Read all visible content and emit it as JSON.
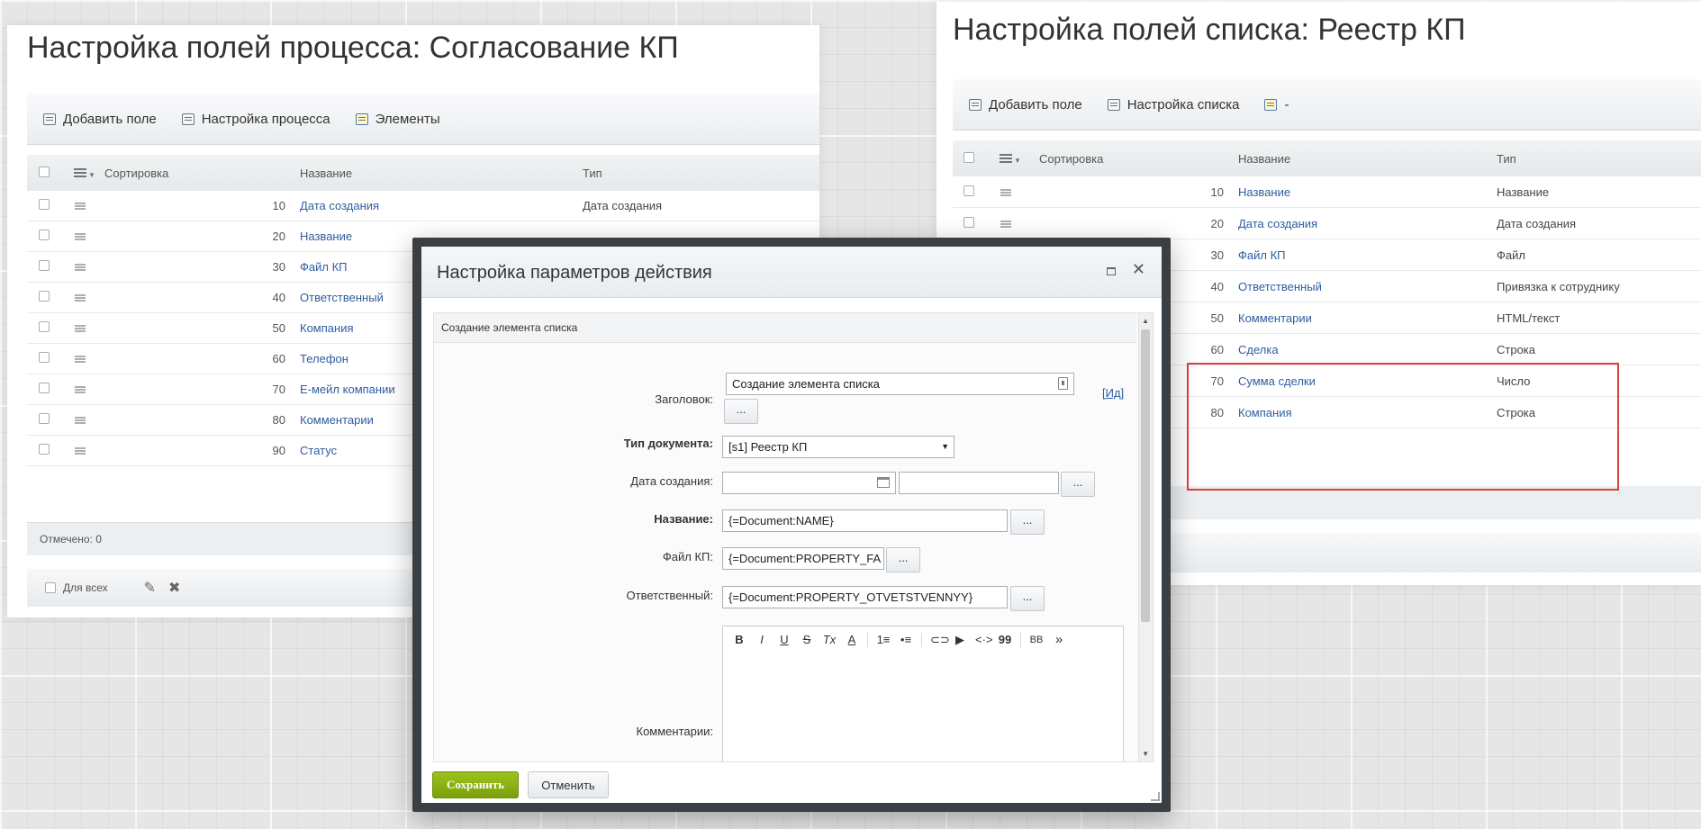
{
  "left_panel": {
    "title": "Настройка полей процесса: Согласование КП",
    "toolbar": [
      {
        "label": "Добавить поле",
        "icon": "add-field-icon"
      },
      {
        "label": "Настройка процесса",
        "icon": "settings-icon"
      },
      {
        "label": "Элементы",
        "icon": "elements-icon"
      }
    ],
    "columns": {
      "sort": "Сортировка",
      "name": "Название",
      "type": "Тип"
    },
    "rows": [
      {
        "sort": "10",
        "name": "Дата создания",
        "type": "Дата создания"
      },
      {
        "sort": "20",
        "name": "Название",
        "type": ""
      },
      {
        "sort": "30",
        "name": "Файл КП",
        "type": ""
      },
      {
        "sort": "40",
        "name": "Ответственный",
        "type": ""
      },
      {
        "sort": "50",
        "name": "Компания",
        "type": ""
      },
      {
        "sort": "60",
        "name": "Телефон",
        "type": ""
      },
      {
        "sort": "70",
        "name": "Е-мейл компании",
        "type": ""
      },
      {
        "sort": "80",
        "name": "Комментарии",
        "type": ""
      },
      {
        "sort": "90",
        "name": "Статус",
        "type": ""
      }
    ],
    "footer": "Отмечено: 0",
    "for_all": "Для всех"
  },
  "right_panel": {
    "title": "Настройка полей списка: Реестр КП",
    "toolbar": [
      {
        "label": "Добавить поле",
        "icon": "add-field-icon"
      },
      {
        "label": "Настройка списка",
        "icon": "settings-icon"
      },
      {
        "label": "-",
        "icon": "elements-icon"
      }
    ],
    "columns": {
      "sort": "Сортировка",
      "name": "Название",
      "type": "Тип"
    },
    "rows": [
      {
        "sort": "10",
        "name": "Название",
        "type": "Название"
      },
      {
        "sort": "20",
        "name": "Дата создания",
        "type": "Дата создания"
      },
      {
        "sort": "30",
        "name": "Файл КП",
        "type": "Файл"
      },
      {
        "sort": "40",
        "name": "Ответственный",
        "type": "Привязка к сотруднику"
      },
      {
        "sort": "50",
        "name": "Комментарии",
        "type": "HTML/текст"
      },
      {
        "sort": "60",
        "name": "Сделка",
        "type": "Строка"
      },
      {
        "sort": "70",
        "name": "Сумма сделки",
        "type": "Число"
      },
      {
        "sort": "80",
        "name": "Компания",
        "type": "Строка"
      }
    ]
  },
  "dialog": {
    "title": "Настройка параметров действия",
    "section": "Создание элемента списка",
    "fields": {
      "header_label": "Заголовок:",
      "header_value": "Создание элемента списка",
      "id_link": "[Ид]",
      "doctype_label": "Тип документа:",
      "doctype_value": "[s1] Реестр КП",
      "date_label": "Дата создания:",
      "name_label": "Название:",
      "name_value": "{=Document:NAME}",
      "file_label": "Файл КП:",
      "file_value": "{=Document:PROPERTY_FA",
      "resp_label": "Ответственный:",
      "resp_value": "{=Document:PROPERTY_OTVETSTVENNYY}",
      "comment_label": "Комментарии:",
      "dots": "..."
    },
    "editor_buttons": [
      "B",
      "I",
      "U",
      "S",
      "Tx",
      "A",
      "1≡",
      "•≡",
      "⊂⊃",
      "▶",
      "<·>",
      "99",
      "BB",
      "»"
    ],
    "save": "Сохранить",
    "cancel": "Отменить"
  },
  "colors": {
    "link": "#2f5d9f",
    "highlight_box": "#d9423b",
    "save_button": "#8cb414"
  }
}
